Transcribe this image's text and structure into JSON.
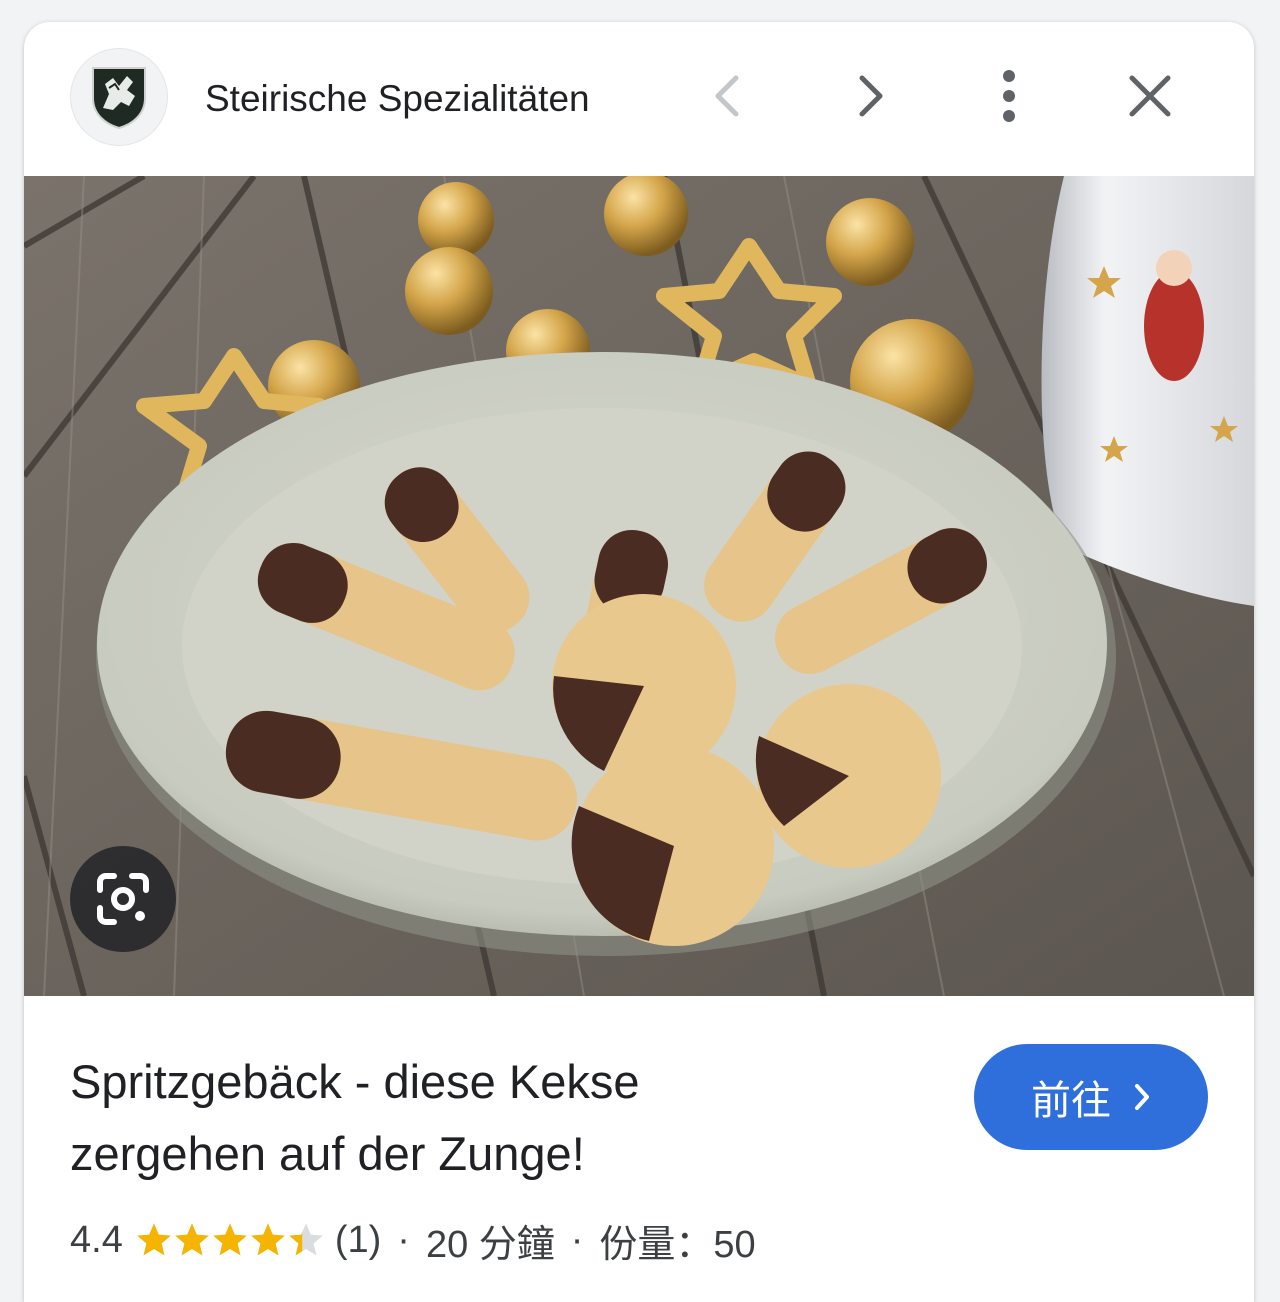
{
  "header": {
    "site_name": "Steirische Spezialitäten",
    "favicon_icon": "coat-of-arms-icon",
    "prev_icon": "chevron-left-icon",
    "next_icon": "chevron-right-icon",
    "more_icon": "more-vert-icon",
    "close_icon": "close-icon"
  },
  "image": {
    "lens_icon": "google-lens-icon"
  },
  "recipe": {
    "title": "Spritzgebäck - diese Kekse zergehen auf der Zunge!",
    "visit_label": "前往",
    "visit_icon": "chevron-right-icon",
    "rating": "4.4",
    "rating_value": 4.4,
    "rating_max": 5,
    "review_count": "(1)",
    "separator": "·",
    "time": "20 分鐘",
    "servings": "份量：50"
  },
  "colors": {
    "accent": "#2f6fdc",
    "star": "#f4b400",
    "star_empty": "#dadce0"
  }
}
